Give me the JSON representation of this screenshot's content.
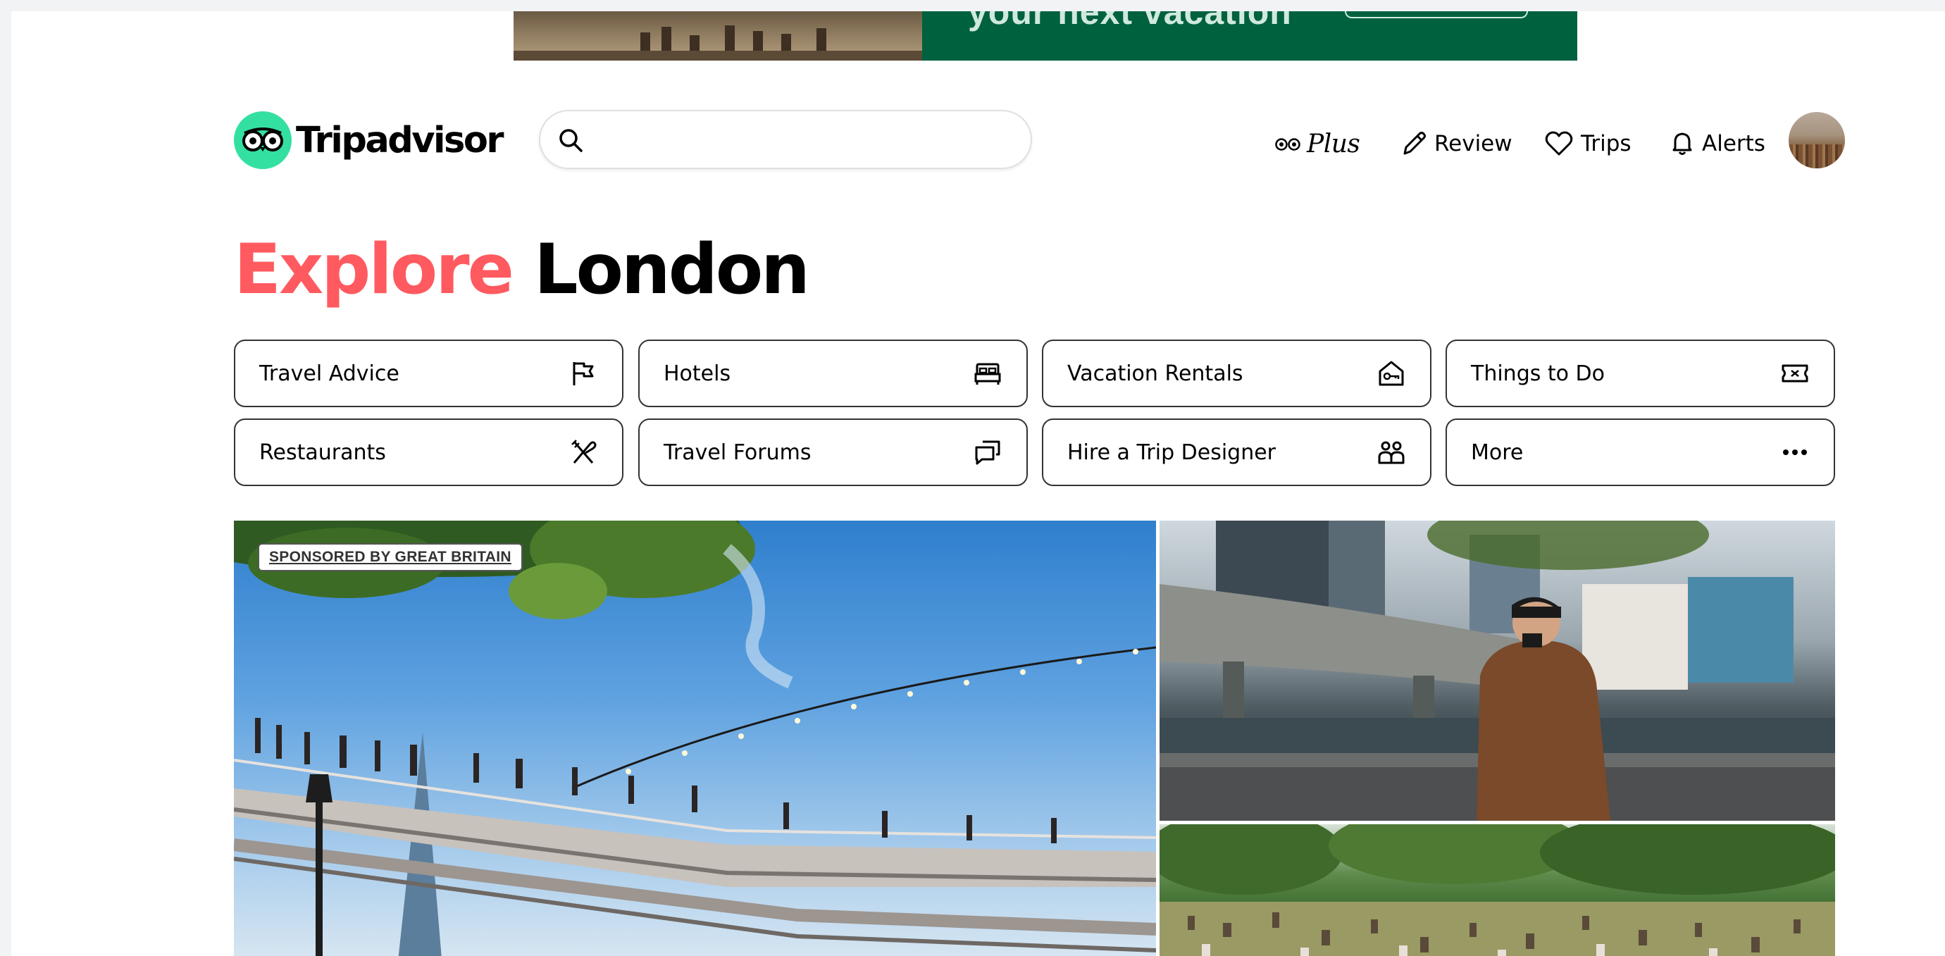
{
  "ad": {
    "text": "your next vacation",
    "brand_green": "#00613f"
  },
  "header": {
    "logo_text": "Tripadvisor",
    "logo_mark_color": "#34e0a1",
    "search": {
      "placeholder": "",
      "value": ""
    },
    "nav": [
      {
        "label": "Plus",
        "icon": "owl-eyes-icon"
      },
      {
        "label": "Review",
        "icon": "pencil-icon"
      },
      {
        "label": "Trips",
        "icon": "heart-icon"
      },
      {
        "label": "Alerts",
        "icon": "bell-icon"
      }
    ],
    "avatar_icon": "user-avatar"
  },
  "main": {
    "title_accent": "Explore",
    "title_rest": " London",
    "accent_color": "#ff5a5f",
    "categories": [
      {
        "label": "Travel Advice",
        "icon": "flag-icon"
      },
      {
        "label": "Hotels",
        "icon": "bed-icon"
      },
      {
        "label": "Vacation Rentals",
        "icon": "house-key-icon"
      },
      {
        "label": "Things to Do",
        "icon": "ticket-icon"
      },
      {
        "label": "Restaurants",
        "icon": "fork-knife-icon"
      },
      {
        "label": "Travel Forums",
        "icon": "chat-bubbles-icon"
      },
      {
        "label": "Hire a Trip Designer",
        "icon": "people-icon"
      },
      {
        "label": "More",
        "icon": "ellipsis-icon"
      }
    ],
    "sponsor_badge": "SPONSORED BY GREAT BRITAIN"
  }
}
